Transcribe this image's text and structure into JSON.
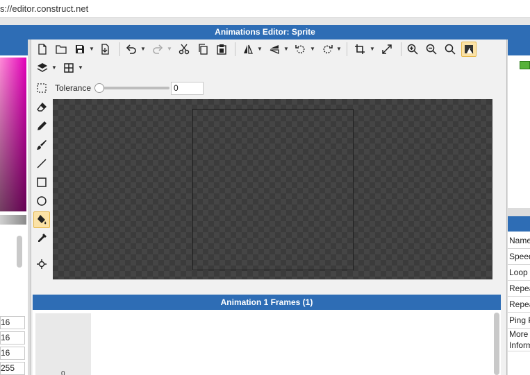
{
  "browser": {
    "url": "s://editor.construct.net"
  },
  "window": {
    "title": "Animations Editor: Sprite"
  },
  "toolbar": {
    "buttons": [
      "new-icon",
      "open-icon",
      "save-icon",
      "export-icon",
      "undo-icon",
      "redo-icon",
      "cut-icon",
      "copy-icon",
      "paste-icon",
      "flip-horizontal-icon",
      "flip-vertical-icon",
      "rotate-left-icon",
      "rotate-right-icon",
      "crop-icon",
      "resize-icon",
      "zoom-in-icon",
      "zoom-out-icon",
      "zoom-reset-icon",
      "background-toggle-icon"
    ],
    "row2": [
      "layers-icon",
      "grid-icon"
    ]
  },
  "tolerance": {
    "label": "Tolerance",
    "value": "0",
    "slider_level": 0
  },
  "tools": [
    "rectangle-select-icon",
    "eraser-icon",
    "pencil-icon",
    "brush-icon",
    "line-icon",
    "rectangle-icon",
    "ellipse-icon",
    "fill-icon",
    "eyedropper-icon",
    "origin-point-icon"
  ],
  "active_tool": "fill-icon",
  "frames": {
    "title": "Animation 1 Frames (1)",
    "frame_number": "0"
  },
  "color_fields": [
    "16",
    "16",
    "16",
    "255"
  ],
  "properties": [
    "Name",
    "Speed",
    "Loop",
    "Repeat",
    "Repeat",
    "Ping P",
    "More",
    "Inform"
  ],
  "colors": {
    "accent": "#2e6db5",
    "canvas": "#3b3b3b",
    "active_tool": "#fbe2a6"
  }
}
